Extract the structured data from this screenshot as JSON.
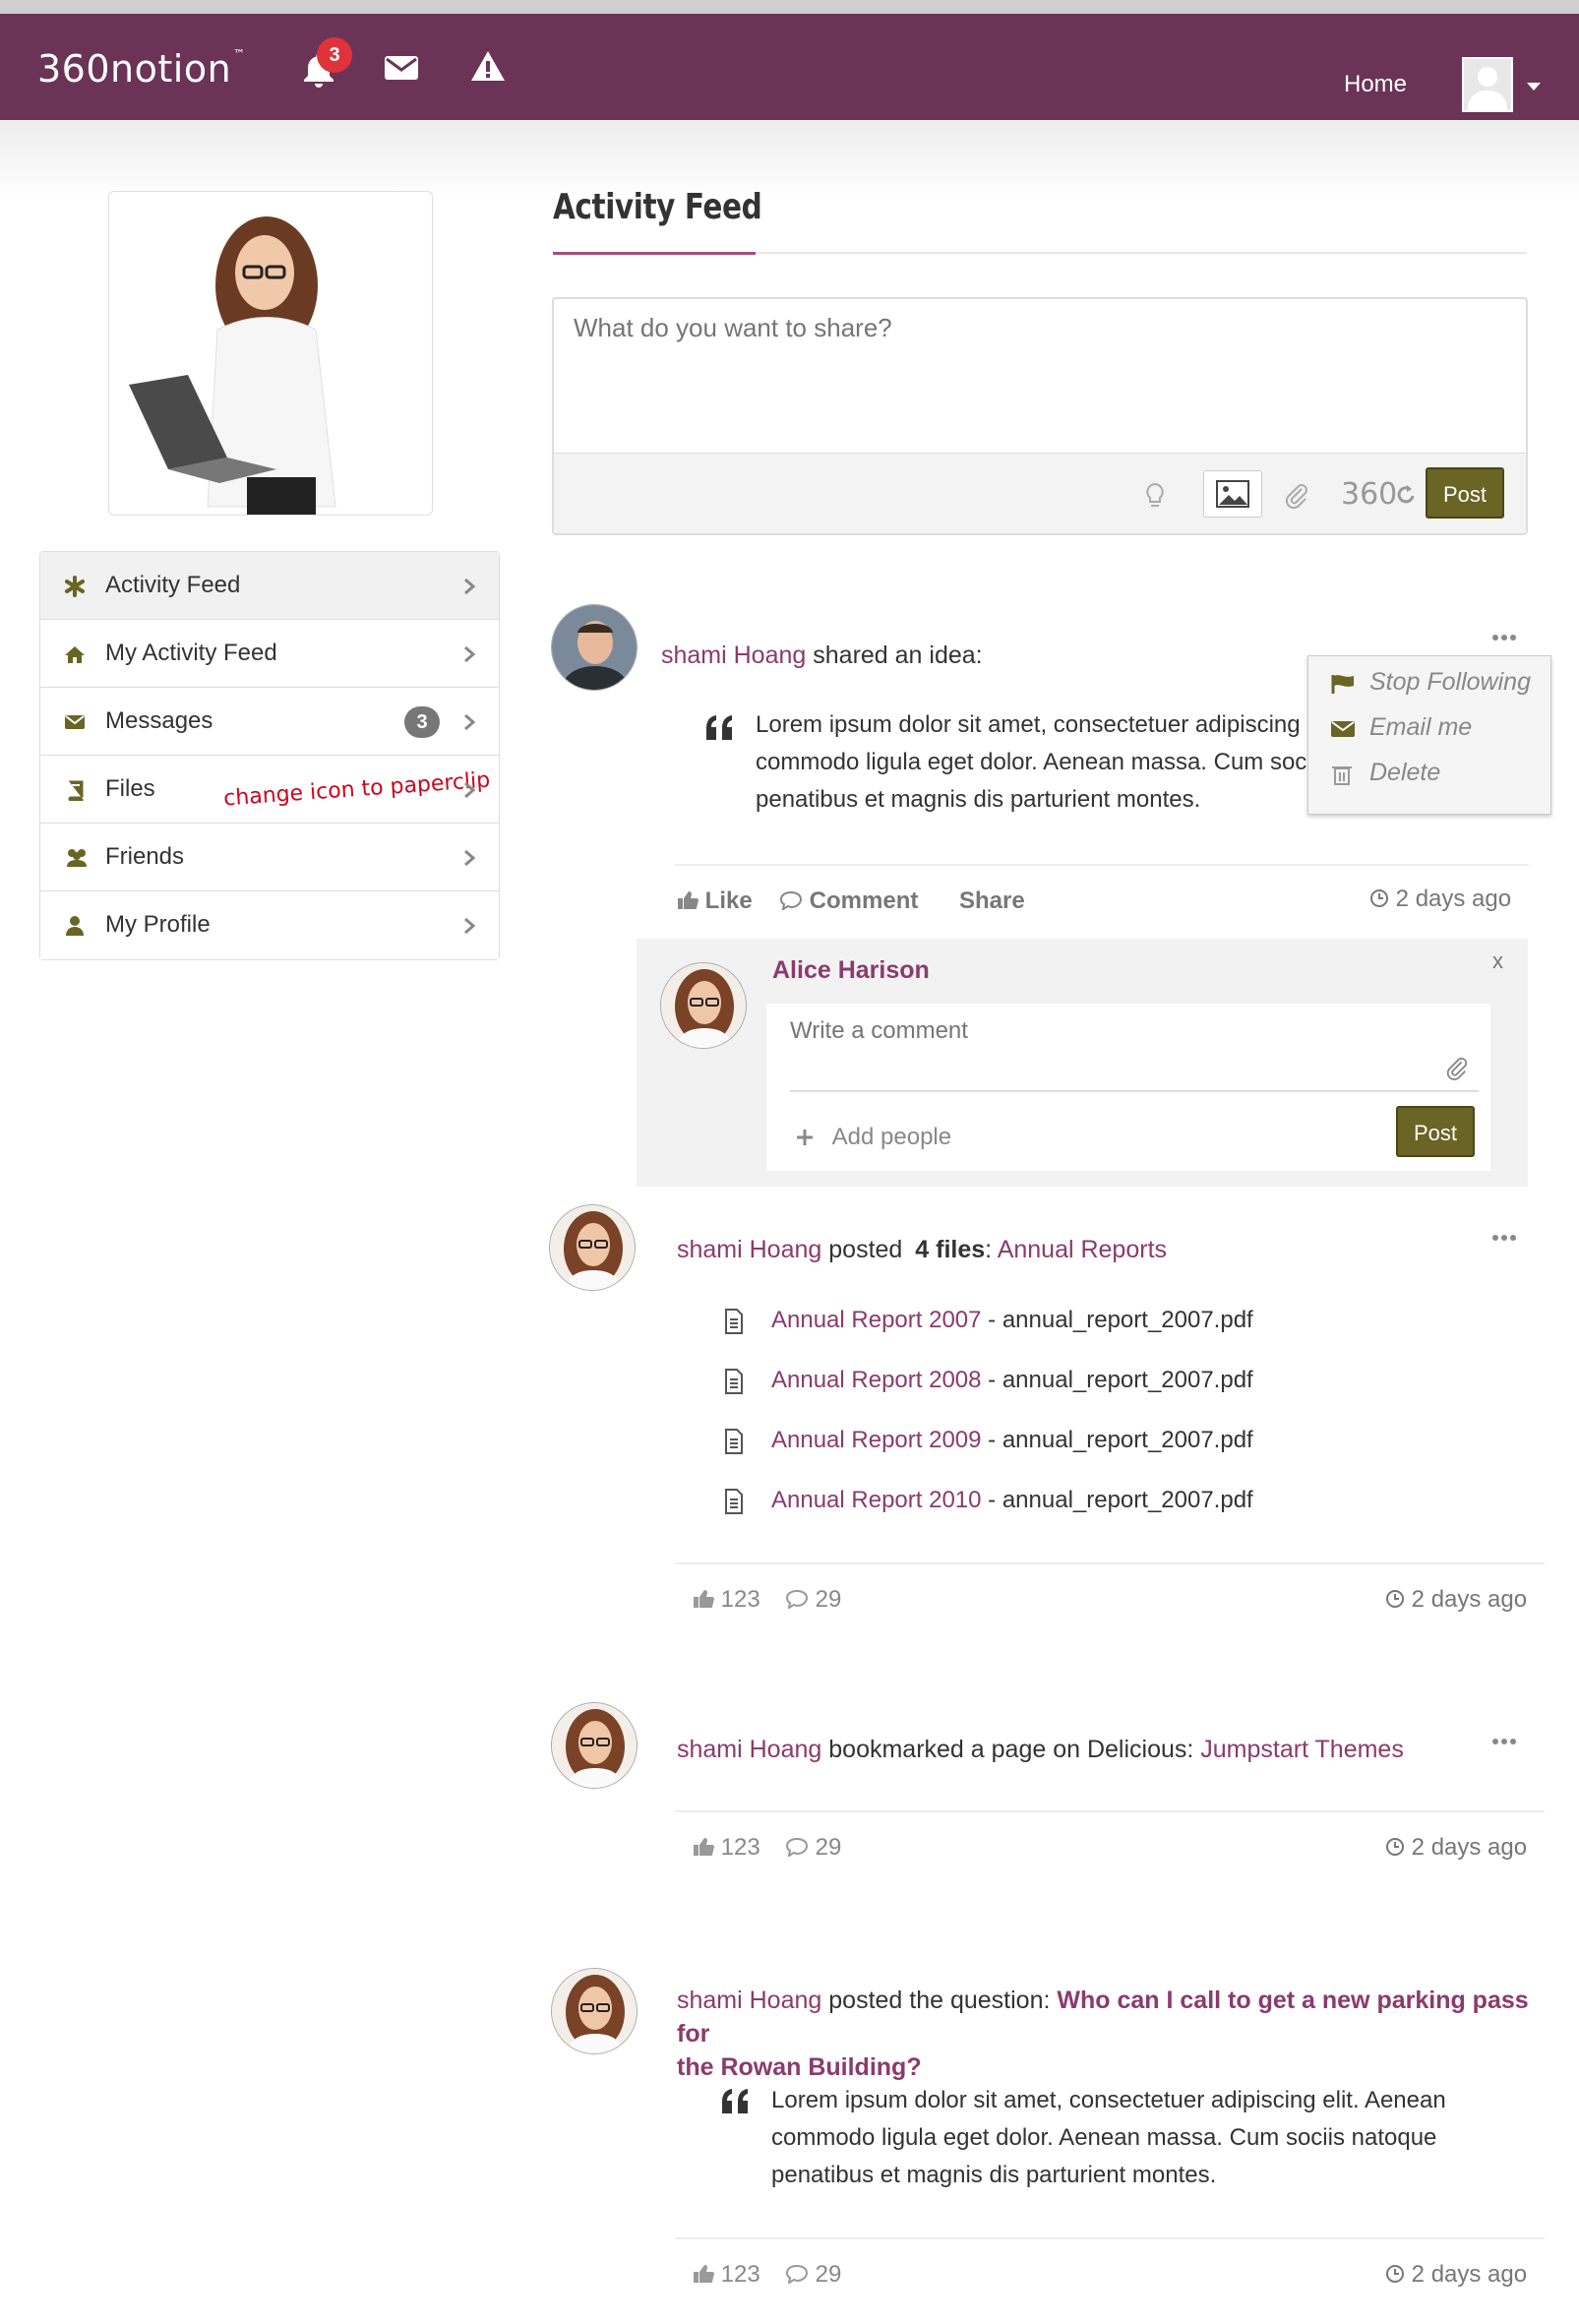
{
  "header": {
    "logo": "360notion",
    "logo_tm": "™",
    "notification_count": "3",
    "nav_home": "Home"
  },
  "sidebar": {
    "items": [
      {
        "label": "Activity Feed",
        "icon": "asterisk-icon"
      },
      {
        "label": "My Activity Feed",
        "icon": "home-icon"
      },
      {
        "label": "Messages",
        "icon": "envelope-icon",
        "badge": "3"
      },
      {
        "label": "Files",
        "icon": "book-icon",
        "note": "change icon to paperclip"
      },
      {
        "label": "Friends",
        "icon": "users-icon"
      },
      {
        "label": "My Profile",
        "icon": "user-icon"
      }
    ]
  },
  "main": {
    "title": "Activity Feed",
    "composer": {
      "placeholder": "What do you want to share?",
      "brand_text": "360",
      "post_label": "Post"
    }
  },
  "posts": [
    {
      "author": "shami Hoang",
      "action": "shared an idea:",
      "body": "Lorem ipsum dolor sit amet, consectetuer adipiscing commodo ligula eget dolor. Aenean massa. Cum soc penatibus et magnis dis parturient montes.",
      "menu": [
        "Stop Following",
        "Email me",
        "Delete"
      ],
      "like_label": "Like",
      "comment_label": "Comment",
      "share_label": "Share",
      "time": "2 days ago",
      "comment_form": {
        "user": "Alice Harison",
        "close": "x",
        "placeholder": "Write a comment",
        "add_people": "Add people",
        "post_label": "Post"
      }
    },
    {
      "author": "shami Hoang",
      "action": "posted",
      "files_count": "4 files",
      "separator": ":",
      "collection": "Annual Reports",
      "files": [
        {
          "title": "Annual Report 2007",
          "filename": " - annual_report_2007.pdf"
        },
        {
          "title": "Annual Report 2008",
          "filename": " - annual_report_2007.pdf"
        },
        {
          "title": "Annual Report 2009",
          "filename": " - annual_report_2007.pdf"
        },
        {
          "title": "Annual Report 2010",
          "filename": " - annual_report_2007.pdf"
        }
      ],
      "likes": "123",
      "comments": "29",
      "time": "2 days ago"
    },
    {
      "author": "shami Hoang",
      "action": "bookmarked a page on Delicious:",
      "link": "Jumpstart Themes",
      "likes": "123",
      "comments": "29",
      "time": "2 days ago"
    },
    {
      "author": "shami Hoang",
      "action": "posted the question:",
      "question_line1": "Who can I call to get a new parking pass for",
      "question_line2": "the Rowan Building?",
      "body": "Lorem ipsum dolor sit amet, consectetuer adipiscing elit. Aenean commodo ligula eget dolor. Aenean massa. Cum sociis natoque penatibus et magnis dis parturient montes.",
      "likes": "123",
      "comments": "29",
      "time": "2 days ago"
    }
  ],
  "colors": {
    "navbar": "#6b3456",
    "accent": "#8b3a6e",
    "post_button": "#6a6425",
    "badge": "#e0323a"
  }
}
